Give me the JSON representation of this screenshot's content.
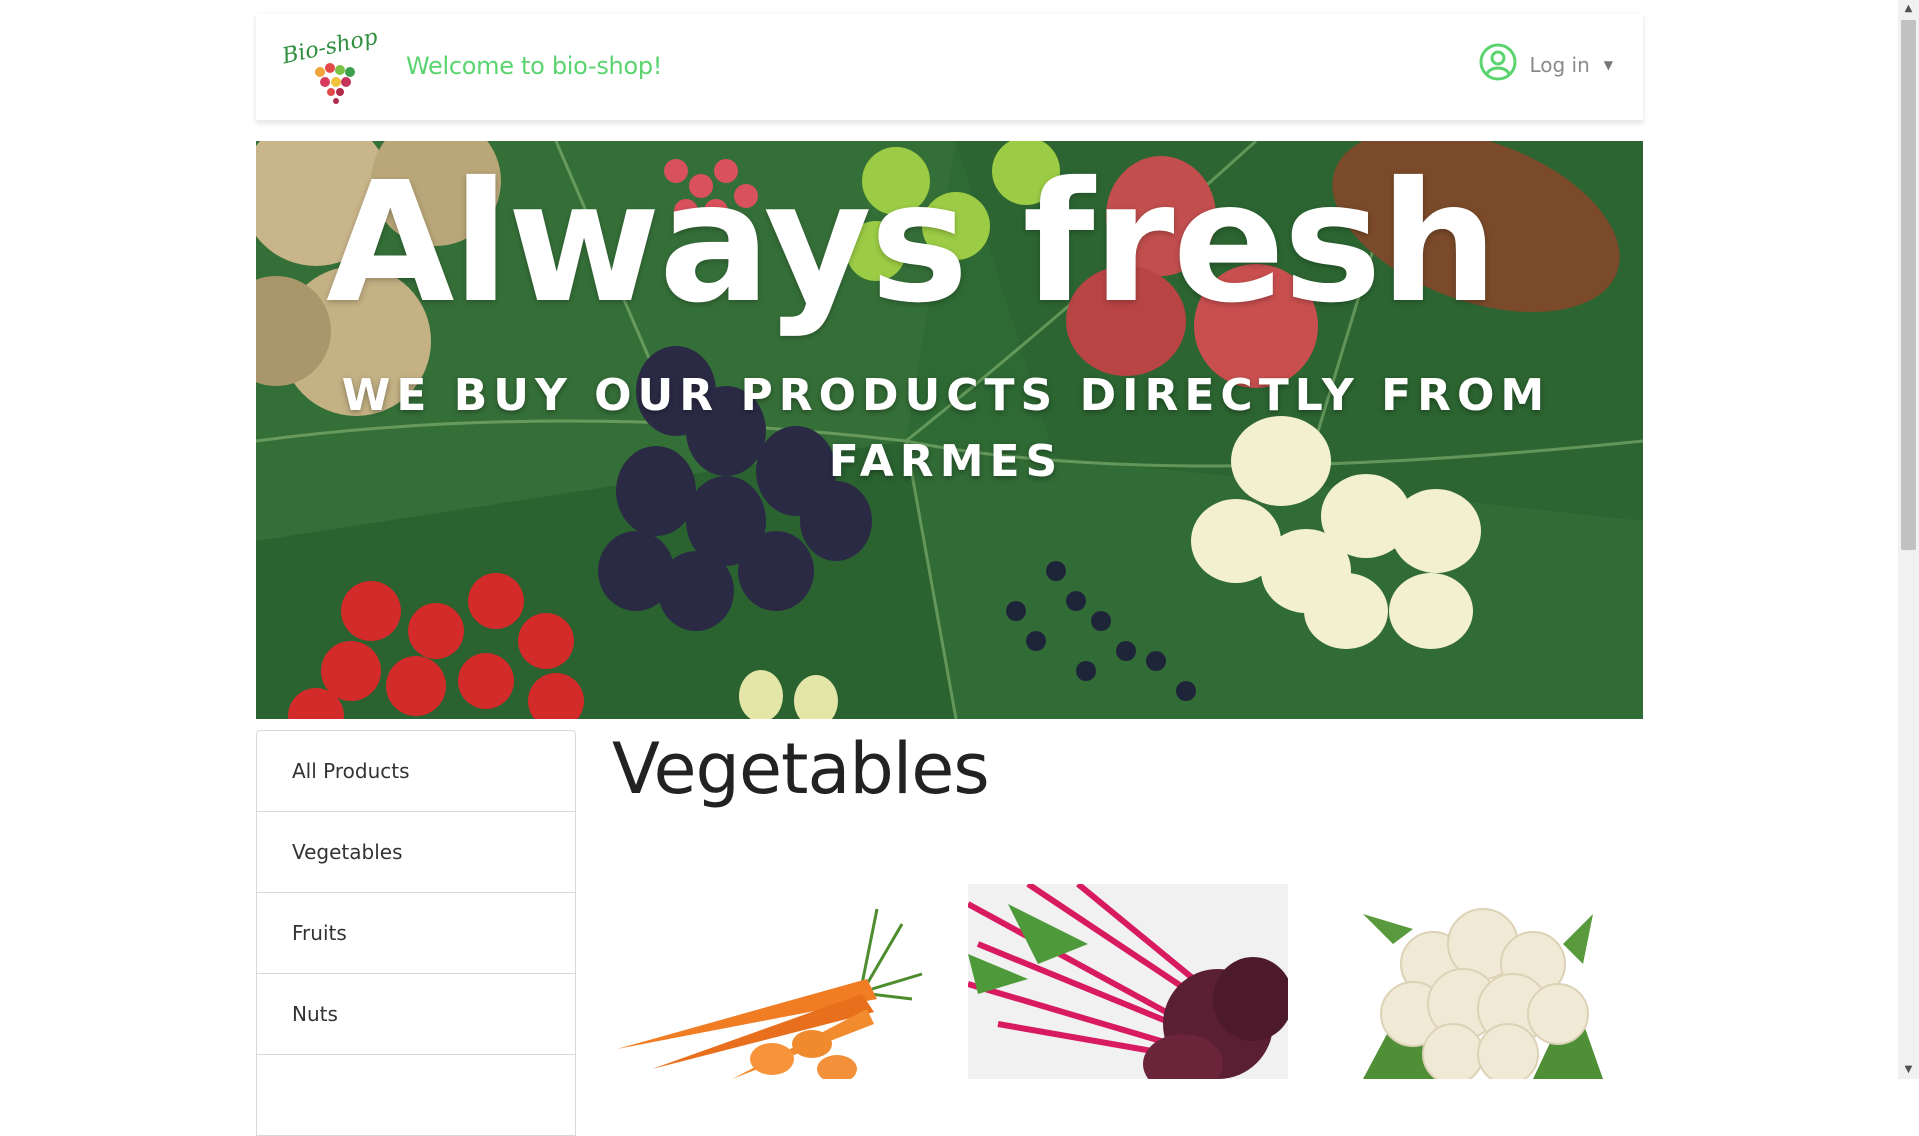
{
  "navbar": {
    "logo_text": "Bio-shop",
    "welcome": "Welcome to bio-shop!",
    "login_label": "Log in",
    "accent_color": "#5bd46f"
  },
  "hero": {
    "title": "Always fresh",
    "subtitle": "WE BUY OUR PRODUCTS DIRECTLY FROM FARMES"
  },
  "sidebar": {
    "items": [
      {
        "label": "All Products"
      },
      {
        "label": "Vegetables"
      },
      {
        "label": "Fruits"
      },
      {
        "label": "Nuts"
      },
      {
        "label": ""
      }
    ]
  },
  "main": {
    "heading": "Vegetables",
    "products": [
      {
        "image": "carrots"
      },
      {
        "image": "beetroot"
      },
      {
        "image": "cauliflower"
      }
    ]
  }
}
